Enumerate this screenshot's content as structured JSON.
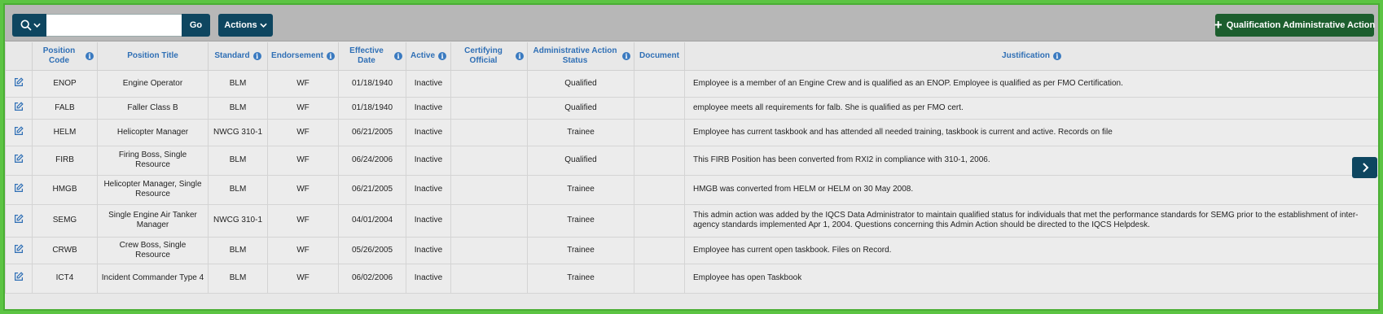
{
  "toolbar": {
    "search_placeholder": "",
    "go_label": "Go",
    "actions_label": "Actions",
    "qualification_action_label": "Qualification Administrative Action"
  },
  "columns": [
    {
      "label": "Position Code",
      "info": true
    },
    {
      "label": "Position Title",
      "info": false
    },
    {
      "label": "Standard",
      "info": true
    },
    {
      "label": "Endorsement",
      "info": true
    },
    {
      "label": "Effective Date",
      "info": true
    },
    {
      "label": "Active",
      "info": true
    },
    {
      "label": "Certifying Official",
      "info": true
    },
    {
      "label": "Administrative Action Status",
      "info": true
    },
    {
      "label": "Document",
      "info": false
    },
    {
      "label": "Justification",
      "info": true
    }
  ],
  "rows": [
    {
      "code": "ENOP",
      "title": "Engine Operator",
      "standard": "BLM",
      "endorsement": "WF",
      "date": "01/18/1940",
      "active": "Inactive",
      "official": "",
      "status": "Qualified",
      "document": "",
      "justification": "Employee is a member of an Engine Crew and is qualified as an ENOP. Employee is qualified as per FMO Certification."
    },
    {
      "code": "FALB",
      "title": "Faller Class B",
      "standard": "BLM",
      "endorsement": "WF",
      "date": "01/18/1940",
      "active": "Inactive",
      "official": "",
      "status": "Qualified",
      "document": "",
      "justification": "employee meets all requirements for falb. She is qualified as per FMO cert."
    },
    {
      "code": "HELM",
      "title": "Helicopter Manager",
      "standard": "NWCG 310-1",
      "endorsement": "WF",
      "date": "06/21/2005",
      "active": "Inactive",
      "official": "",
      "status": "Trainee",
      "document": "",
      "justification": "Employee has current taskbook and has attended all needed training, taskbook is current and active. Records on file"
    },
    {
      "code": "FIRB",
      "title": "Firing Boss, Single Resource",
      "standard": "BLM",
      "endorsement": "WF",
      "date": "06/24/2006",
      "active": "Inactive",
      "official": "",
      "status": "Qualified",
      "document": "",
      "justification": "This FIRB Position has been converted from RXI2 in compliance with 310-1, 2006."
    },
    {
      "code": "HMGB",
      "title": "Helicopter Manager, Single Resource",
      "standard": "BLM",
      "endorsement": "WF",
      "date": "06/21/2005",
      "active": "Inactive",
      "official": "",
      "status": "Trainee",
      "document": "",
      "justification": "HMGB was converted from HELM or HELM on 30 May 2008."
    },
    {
      "code": "SEMG",
      "title": "Single Engine Air Tanker Manager",
      "standard": "NWCG 310-1",
      "endorsement": "WF",
      "date": "04/01/2004",
      "active": "Inactive",
      "official": "",
      "status": "Trainee",
      "document": "",
      "justification": "This admin action was added by the IQCS Data Administrator to maintain qualified status for individuals that met the performance standards for SEMG prior to the establishment of inter-agency standards implemented Apr 1, 2004. Questions concerning this Admin Action should be directed to the IQCS Helpdesk."
    },
    {
      "code": "CRWB",
      "title": "Crew Boss, Single Resource",
      "standard": "BLM",
      "endorsement": "WF",
      "date": "05/26/2005",
      "active": "Inactive",
      "official": "",
      "status": "Trainee",
      "document": "",
      "justification": "Employee has current open taskbook. Files on Record."
    },
    {
      "code": "ICT4",
      "title": "Incident Commander Type 4",
      "standard": "BLM",
      "endorsement": "WF",
      "date": "06/02/2006",
      "active": "Inactive",
      "official": "",
      "status": "Trainee",
      "document": "",
      "justification": "Employee has open Taskbook"
    }
  ],
  "icons": {
    "search": "search-icon",
    "chevron": "chevron-down-icon",
    "plus": "plus-icon",
    "edit": "edit-icon",
    "info": "info-icon",
    "next": "chevron-right-icon"
  },
  "colors": {
    "primary_button": "#0e4660",
    "success_button": "#1c5e2e",
    "header_text": "#2f6fb5",
    "frame_border": "#5cc443"
  }
}
